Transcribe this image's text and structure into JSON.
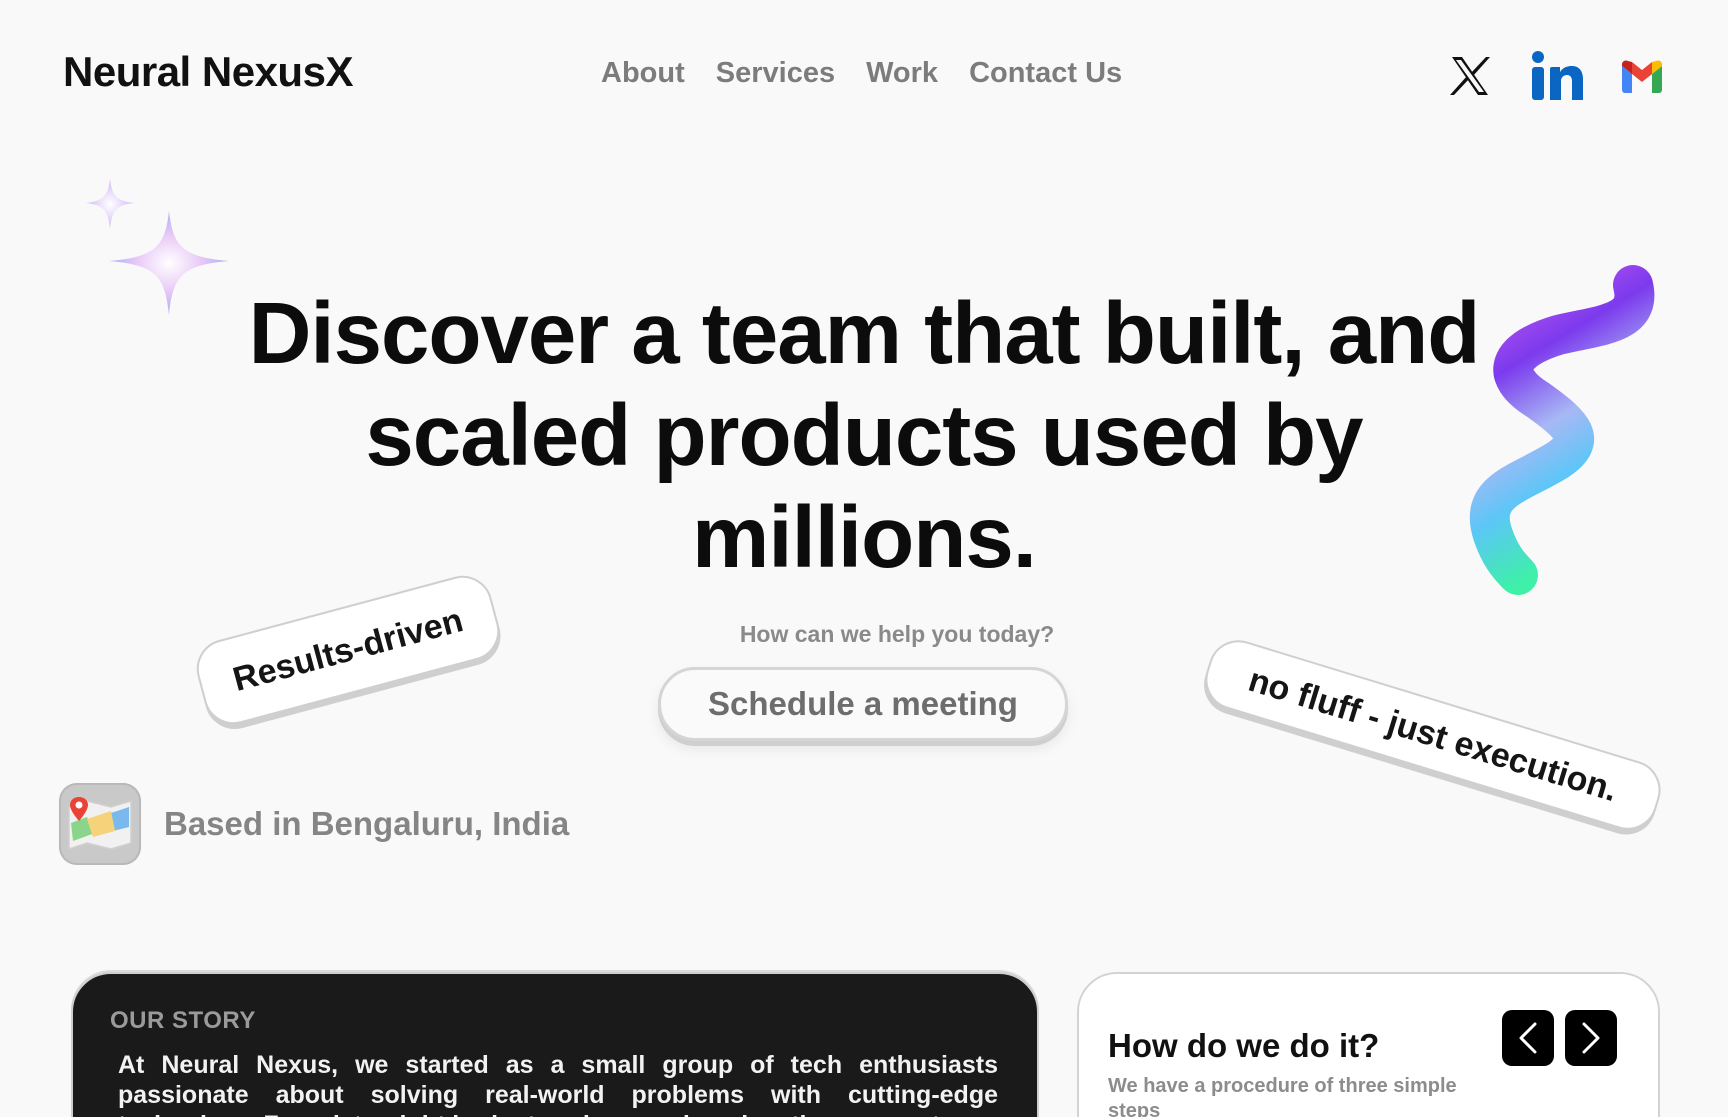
{
  "header": {
    "brand": "Neural NexusX",
    "nav": [
      {
        "label": "About"
      },
      {
        "label": "Services"
      },
      {
        "label": "Work"
      },
      {
        "label": "Contact Us"
      }
    ],
    "socials": [
      "x-icon",
      "linkedin-icon",
      "gmail-icon"
    ]
  },
  "hero": {
    "title": "Discover a team that built, and scaled products used by millions.",
    "help_text": "How can we help you today?",
    "cta_label": "Schedule a meeting",
    "tag_left": "Results-driven",
    "tag_right": "no fluff - just execution.",
    "location": "Based in Bengaluru, India"
  },
  "story": {
    "label": "OUR STORY",
    "text": "At Neural Nexus, we started as a small group of tech enthusiasts passionate about solving real-world problems with cutting-edge technology. From late-night brainstorming sessions in a tiny garage to"
  },
  "how": {
    "title": "How do we do it?",
    "subtitle": "We have a procedure of three simple steps"
  },
  "colors": {
    "background": "#f9f9f9",
    "text_dark": "#0c0c0c",
    "text_muted": "#7c7c7c",
    "card_dark": "#1a1a1a",
    "linkedin": "#0a66c2"
  }
}
